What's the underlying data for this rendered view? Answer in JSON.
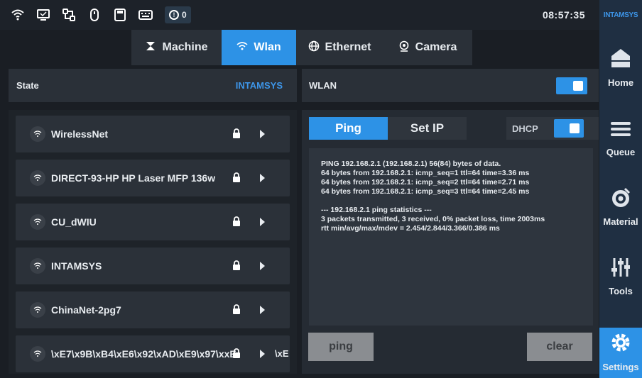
{
  "status_bar": {
    "icons": [
      "wifi-icon",
      "monitor-icon",
      "network-icon",
      "mouse-icon",
      "usb-drive-icon",
      "keyboard-icon"
    ],
    "alert_count": "0",
    "time": "08:57:35"
  },
  "brand": "INTAMSYS",
  "tabs": [
    {
      "label": "Machine",
      "icon": "machine-icon",
      "active": false
    },
    {
      "label": "Wlan",
      "icon": "wifi-icon",
      "active": true
    },
    {
      "label": "Ethernet",
      "icon": "globe-icon",
      "active": false
    },
    {
      "label": "Camera",
      "icon": "camera-icon",
      "active": false
    }
  ],
  "sidebar": [
    {
      "label": "Home",
      "icon": "home-icon",
      "active": false
    },
    {
      "label": "Queue",
      "icon": "queue-icon",
      "active": false
    },
    {
      "label": "Material",
      "icon": "material-icon",
      "active": false
    },
    {
      "label": "Tools",
      "icon": "tools-icon",
      "active": false
    },
    {
      "label": "Settings",
      "icon": "settings-icon",
      "active": true
    }
  ],
  "state": {
    "label": "State",
    "value": "INTAMSYS"
  },
  "networks": [
    {
      "name": "WirelessNet",
      "extra": ""
    },
    {
      "name": "DIRECT-93-HP HP Laser MFP 136w",
      "extra": ""
    },
    {
      "name": "CU_dWIU",
      "extra": ""
    },
    {
      "name": "INTAMSYS",
      "extra": ""
    },
    {
      "name": "ChinaNet-2pg7",
      "extra": ""
    },
    {
      "name": "\\xE7\\x9B\\xB4\\xE6\\x92\\xAD\\xE9\\x97\\xxE",
      "extra": "\\xE"
    }
  ],
  "wlan": {
    "label": "WLAN",
    "enabled": true
  },
  "ping": {
    "tab_ping": "Ping",
    "tab_setip": "Set IP",
    "dhcp_label": "DHCP",
    "output_lines": [
      "PING 192.168.2.1 (192.168.2.1) 56(84) bytes of data.",
      "64 bytes from 192.168.2.1: icmp_seq=1 ttl=64 time=3.36 ms",
      "64 bytes from 192.168.2.1: icmp_seq=2 ttl=64 time=2.71 ms",
      "64 bytes from 192.168.2.1: icmp_seq=3 ttl=64 time=2.45 ms",
      "",
      "--- 192.168.2.1 ping statistics ---",
      "3 packets transmitted, 3 received, 0% packet loss, time 2003ms",
      "rtt min/avg/max/mdev = 2.454/2.844/3.366/0.386 ms"
    ],
    "ping_button": "ping",
    "clear_button": "clear"
  },
  "colors": {
    "accent": "#2d92e6",
    "background": "#1a1e24",
    "panel": "#2a3038",
    "sidebar": "#1f2f42",
    "button_gray": "#8a8d91"
  }
}
